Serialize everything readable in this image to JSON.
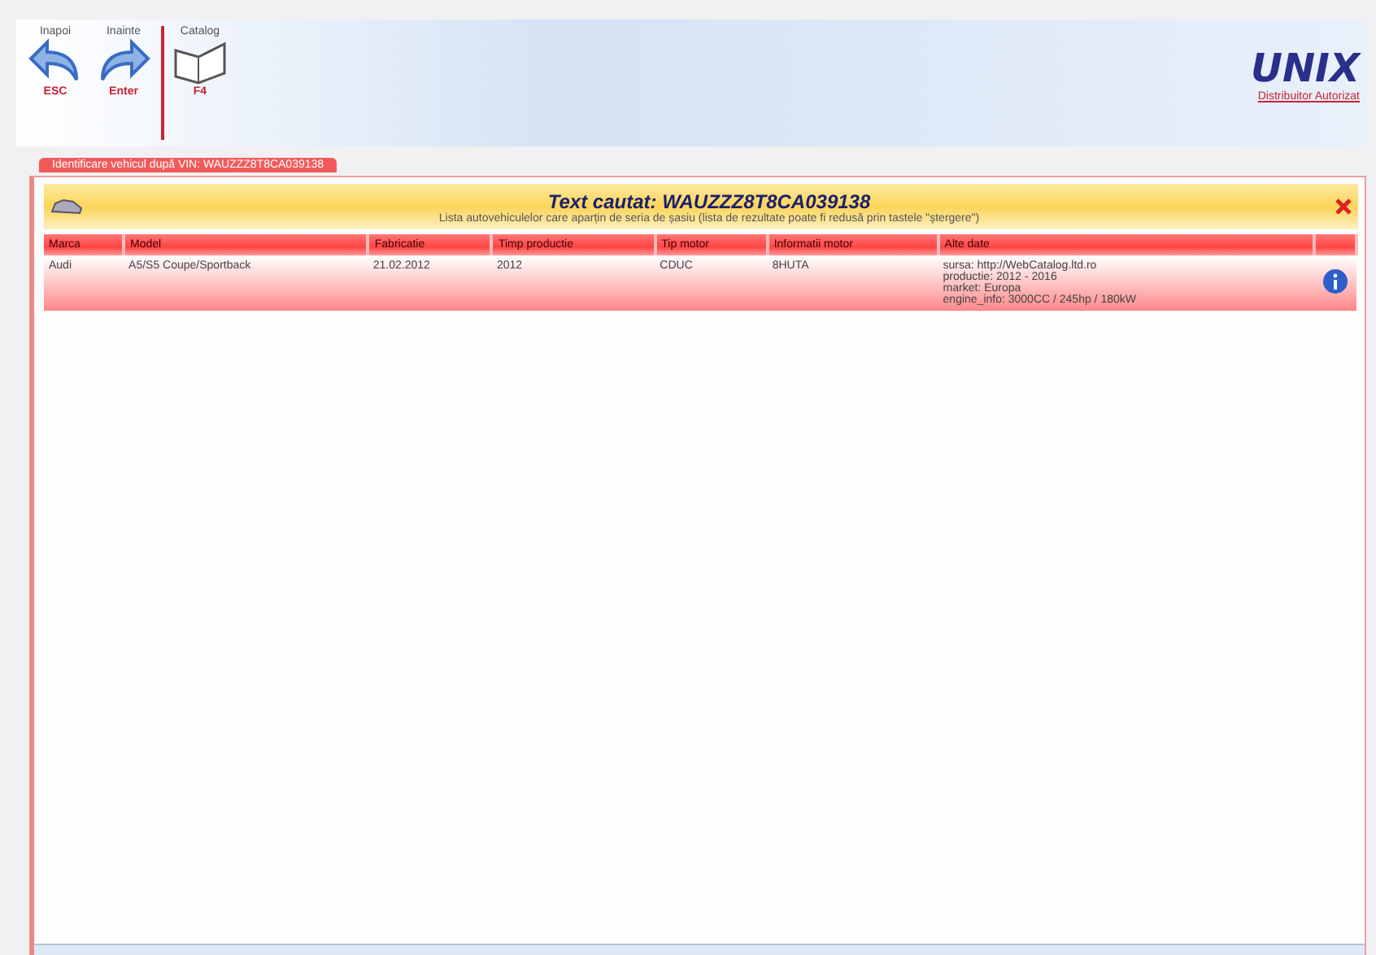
{
  "toolbar": {
    "buttons": [
      {
        "kind": "back",
        "label": "Inapoi",
        "key": "ESC"
      },
      {
        "kind": "forward",
        "label": "Inainte",
        "key": "Enter"
      },
      {
        "kind": "book",
        "label": "Catalog",
        "key": "F4"
      }
    ]
  },
  "logo": {
    "name": "UNIX",
    "tagline": "Distribuitor Autorizat"
  },
  "tab": {
    "label": "Identificare vehicul după VIN: WAUZZZ8T8CA039138",
    "selected": true
  },
  "panel": {
    "title": "Text cautat: WAUZZZ8T8CA039138",
    "subtitle": "Lista autovehiculelor care aparțin de seria de șasiu (lista de rezultate poate fi redusă prin tastele \"ștergere\")"
  },
  "table": {
    "columns": [
      "Marca",
      "Model",
      "Fabricatie",
      "Timp productie",
      "Tip motor",
      "Informatii motor",
      "Alte date"
    ],
    "rows": [
      {
        "cells": [
          "Audi",
          "A5/S5 Coupe/Sportback",
          "21.02.2012",
          "2012",
          "CDUC",
          "8HUTA"
        ],
        "details": [
          "sursa: http://WebCatalog.ltd.ro",
          "productie: 2012 - 2016",
          "market: Europa",
          "engine_info: 3000CC / 245hp / 180kW"
        ]
      }
    ]
  }
}
